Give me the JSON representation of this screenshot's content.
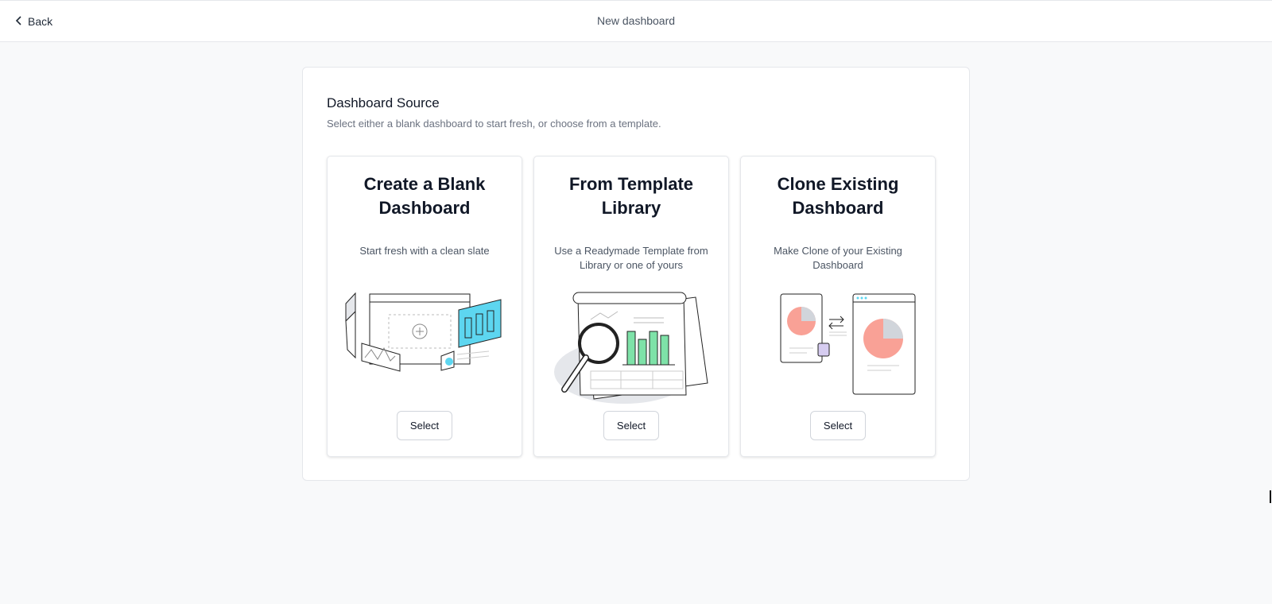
{
  "header": {
    "back_label": "Back",
    "title": "New dashboard"
  },
  "source": {
    "title": "Dashboard Source",
    "subtitle": "Select either a blank dashboard to start fresh, or choose from a template."
  },
  "cards": [
    {
      "title": "Create a Blank Dashboard",
      "description": "Start fresh with a clean slate",
      "button": "Select",
      "illustration": "blank-dashboard-illustration"
    },
    {
      "title": "From Template Library",
      "description": "Use a Readymade Template from Library or one of yours",
      "button": "Select",
      "illustration": "template-library-illustration"
    },
    {
      "title": "Clone Existing Dashboard",
      "description": "Make Clone of your Existing Dashboard",
      "button": "Select",
      "illustration": "clone-dashboard-illustration"
    }
  ],
  "colors": {
    "accent_cyan": "#5dd6f0",
    "accent_green": "#7ee2a8",
    "accent_salmon": "#f9a196",
    "background": "#f8f9fa"
  }
}
